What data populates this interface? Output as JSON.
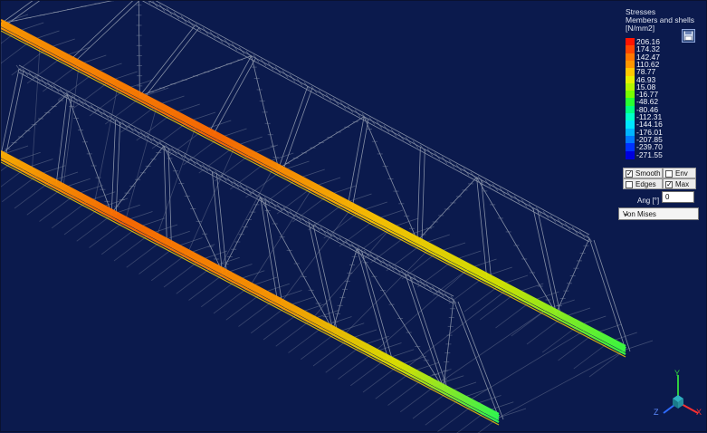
{
  "panel": {
    "title_line1": "Stresses",
    "title_line2": "Members and shells",
    "unit": "[N/mm2]",
    "save_icon": "save-icon"
  },
  "legend": [
    {
      "label": "206.16",
      "color": "#ff1400"
    },
    {
      "label": "174.32",
      "color": "#ff4600"
    },
    {
      "label": "142.47",
      "color": "#ff7800"
    },
    {
      "label": "110.62",
      "color": "#ff9600"
    },
    {
      "label": "78.77",
      "color": "#ffc800"
    },
    {
      "label": "46.93",
      "color": "#e6f000"
    },
    {
      "label": "15.08",
      "color": "#b4f500"
    },
    {
      "label": "-16.77",
      "color": "#78ff00"
    },
    {
      "label": "-48.62",
      "color": "#28ff32"
    },
    {
      "label": "-80.46",
      "color": "#00ff82"
    },
    {
      "label": "-112.31",
      "color": "#00ffc8"
    },
    {
      "label": "-144.16",
      "color": "#00e6ff"
    },
    {
      "label": "-176.01",
      "color": "#00b4ff"
    },
    {
      "label": "-207.85",
      "color": "#0078ff"
    },
    {
      "label": "-239.70",
      "color": "#0032ff"
    },
    {
      "label": "-271.55",
      "color": "#0000dc"
    }
  ],
  "options": {
    "smooth": {
      "label": "Smooth",
      "checked": true
    },
    "env": {
      "label": "Env",
      "checked": false
    },
    "edges": {
      "label": "Edges",
      "checked": false
    },
    "max": {
      "label": "Max",
      "checked": true
    }
  },
  "angle": {
    "label": "Ang [°]",
    "value": "0"
  },
  "result_type": {
    "selected": "Von Mises"
  },
  "axes": {
    "x": "X",
    "y": "Y",
    "z": "Z"
  }
}
